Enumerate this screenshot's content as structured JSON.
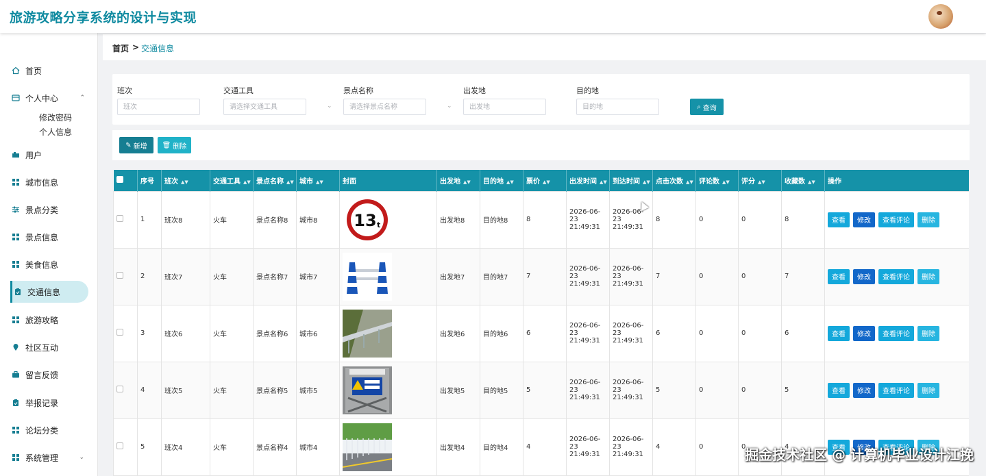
{
  "header": {
    "title": "旅游攻略分享系统的设计与实现"
  },
  "sidebar": {
    "items": [
      {
        "label": "首页",
        "icon": "home-icon"
      },
      {
        "label": "个人中心",
        "icon": "user-card-icon"
      },
      {
        "label": "用户",
        "icon": "user-icon"
      },
      {
        "label": "城市信息",
        "icon": "grid-icon"
      },
      {
        "label": "景点分类",
        "icon": "sliders-icon"
      },
      {
        "label": "景点信息",
        "icon": "grid-icon"
      },
      {
        "label": "美食信息",
        "icon": "grid-icon"
      },
      {
        "label": "交通信息",
        "icon": "clipboard-icon"
      },
      {
        "label": "旅游攻略",
        "icon": "grid-icon"
      },
      {
        "label": "社区互动",
        "icon": "location-icon"
      },
      {
        "label": "留言反馈",
        "icon": "briefcase-icon"
      },
      {
        "label": "举报记录",
        "icon": "clipboard-check-icon"
      },
      {
        "label": "论坛分类",
        "icon": "grid-icon"
      },
      {
        "label": "系统管理",
        "icon": "grid-icon"
      }
    ],
    "sub_items": [
      "修改密码",
      "个人信息"
    ]
  },
  "breadcrumb": {
    "home": "首页",
    "separator": ">",
    "current": "交通信息"
  },
  "search": {
    "fields": [
      {
        "label": "班次",
        "placeholder": "班次"
      },
      {
        "label": "交通工具",
        "placeholder": "请选择交通工具"
      },
      {
        "label": "景点名称",
        "placeholder": "请选择景点名称"
      },
      {
        "label": "出发地",
        "placeholder": "出发地"
      },
      {
        "label": "目的地",
        "placeholder": "目的地"
      }
    ],
    "button": "查询"
  },
  "actions": {
    "add": "新增",
    "delete": "删除"
  },
  "table": {
    "columns": [
      "序号",
      "班次",
      "交通工具",
      "景点名称",
      "城市",
      "封面",
      "出发地",
      "目的地",
      "票价",
      "出发时间",
      "到达时间",
      "点击次数",
      "评论数",
      "评分",
      "收藏数",
      "操作"
    ],
    "ops": {
      "view": "查看",
      "edit": "修改",
      "comments": "查看评论",
      "delete": "删除"
    },
    "rows": [
      {
        "no": "1",
        "shift": "班次8",
        "vehicle": "火车",
        "spot": "景点名称8",
        "city": "城市8",
        "cover": "speed-limit-sign",
        "from": "出发地8",
        "to": "目的地8",
        "price": "8",
        "depart": "2026-06-23 21:49:31",
        "arrive": "2026-06-23 21:49:31",
        "clicks": "8",
        "comments": "0",
        "score": "0",
        "favs": "8"
      },
      {
        "no": "2",
        "shift": "班次7",
        "vehicle": "火车",
        "spot": "景点名称7",
        "city": "城市7",
        "cover": "traffic-barrier",
        "from": "出发地7",
        "to": "目的地7",
        "price": "7",
        "depart": "2026-06-23 21:49:31",
        "arrive": "2026-06-23 21:49:31",
        "clicks": "7",
        "comments": "0",
        "score": "0",
        "favs": "7"
      },
      {
        "no": "3",
        "shift": "班次6",
        "vehicle": "火车",
        "spot": "景点名称6",
        "city": "城市6",
        "cover": "guardrail-road",
        "from": "出发地6",
        "to": "目的地6",
        "price": "6",
        "depart": "2026-06-23 21:49:31",
        "arrive": "2026-06-23 21:49:31",
        "clicks": "6",
        "comments": "0",
        "score": "0",
        "favs": "6"
      },
      {
        "no": "4",
        "shift": "班次5",
        "vehicle": "火车",
        "spot": "景点名称5",
        "city": "城市5",
        "cover": "construction-sign",
        "from": "出发地5",
        "to": "目的地5",
        "price": "5",
        "depart": "2026-06-23 21:49:31",
        "arrive": "2026-06-23 21:49:31",
        "clicks": "5",
        "comments": "0",
        "score": "0",
        "favs": "5"
      },
      {
        "no": "5",
        "shift": "班次4",
        "vehicle": "火车",
        "spot": "景点名称4",
        "city": "城市4",
        "cover": "fence-road",
        "from": "出发地4",
        "to": "目的地4",
        "price": "4",
        "depart": "2026-06-23 21:49:31",
        "arrive": "2026-06-23 21:49:31",
        "clicks": "4",
        "comments": "0",
        "score": "0",
        "favs": "4"
      }
    ]
  },
  "watermark": "掘金技术社区 @ 计算机毕业设计江挽"
}
